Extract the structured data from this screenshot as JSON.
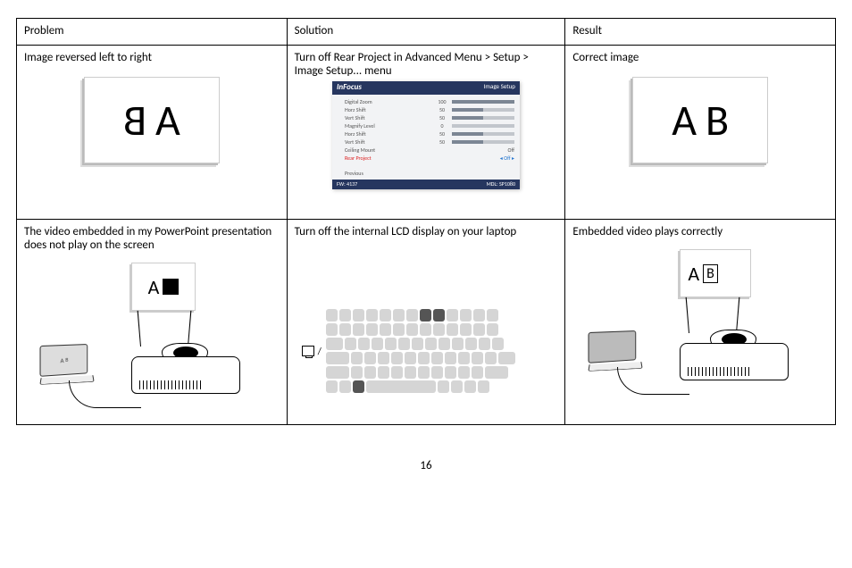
{
  "page_number": "16",
  "headers": {
    "problem": "Problem",
    "solution": "Solution",
    "result": "Result"
  },
  "row1": {
    "problem": "Image reversed left to right",
    "solution": "Turn off Rear Project in Advanced Menu > Setup > Image Setup... menu",
    "result": "Correct image",
    "screen_problem": {
      "left": "B",
      "right": "A"
    },
    "screen_result": {
      "left": "A",
      "right": "B"
    },
    "menu": {
      "brand": "InFocus",
      "title": "Image Setup",
      "items": [
        {
          "label": "Digital Zoom",
          "value": "100",
          "pct": 100
        },
        {
          "label": "Horz Shift",
          "value": "50",
          "pct": 50
        },
        {
          "label": "Vert Shift",
          "value": "50",
          "pct": 50
        },
        {
          "label": "Magnify Level",
          "value": "0",
          "pct": 0
        },
        {
          "label": "Horz Shift",
          "value": "50",
          "pct": 50
        },
        {
          "label": "Vert Shift",
          "value": "50",
          "pct": 50
        },
        {
          "label": "Ceiling Mount",
          "value": "Off"
        },
        {
          "label": "Rear Project",
          "value": "Off",
          "highlight": true
        }
      ],
      "previous": "Previous",
      "footer_left": "FW: 4137",
      "footer_right": "MDL: SP1080"
    }
  },
  "row2": {
    "problem": "The video embedded in my PowerPoint presentation does not play on the screen",
    "solution": "Turn off the internal LCD display on your laptop",
    "result": "Embedded video plays correctly",
    "screen_problem": {
      "letter": "A"
    },
    "screen_result": {
      "letterA": "A",
      "letterB": "B"
    },
    "laptop_screen": {
      "a": "A",
      "b": "B"
    }
  }
}
